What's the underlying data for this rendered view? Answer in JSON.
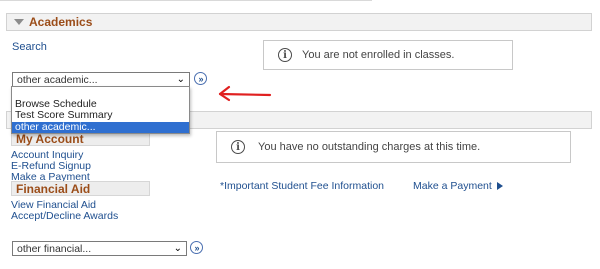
{
  "academics": {
    "title": "Academics",
    "search_link": "Search",
    "enrollment_message": "You are not enrolled in classes.",
    "select_value": "other academic...",
    "dropdown_options": [
      "",
      "Browse Schedule",
      "Test Score Summary",
      "other academic..."
    ],
    "dropdown_selected": "other academic..."
  },
  "finances": {
    "my_account": {
      "title": "My Account",
      "links": [
        "Account Inquiry",
        "E-Refund Signup",
        "Make a Payment"
      ]
    },
    "financial_aid": {
      "title": "Financial Aid",
      "links": [
        "View Financial Aid",
        "Accept/Decline Awards"
      ]
    },
    "charges_message": "You have no outstanding charges at this time.",
    "fee_info_link": "*Important Student Fee Information",
    "make_payment_link": "Make a Payment",
    "select_value": "other financial..."
  },
  "icons": {
    "info": "info-circle-icon",
    "go": "double-chevron-right-icon",
    "annotation": "red-arrow-left"
  },
  "colors": {
    "section_title": "#9b4d19",
    "link": "#1f4f8f",
    "selected_option": "#2f6fd0",
    "annotation_arrow": "#e02020"
  }
}
